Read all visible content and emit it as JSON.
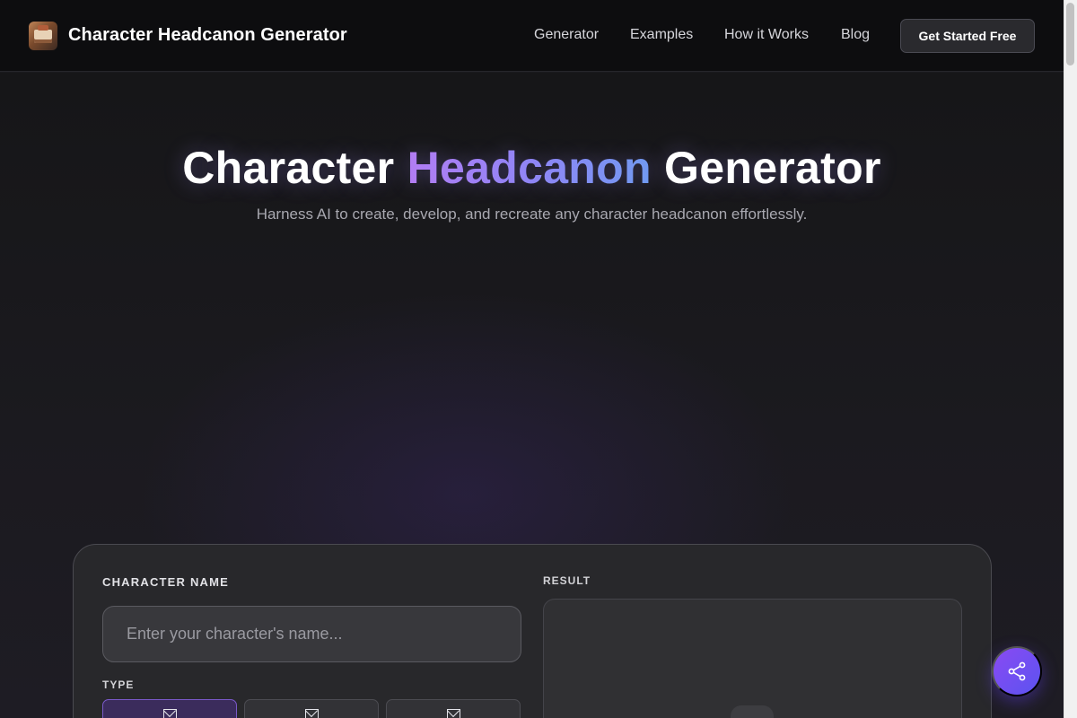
{
  "header": {
    "brand": "Character Headcanon Generator",
    "nav": [
      "Generator",
      "Examples",
      "How it Works",
      "Blog"
    ],
    "cta_label": "Get Started Free"
  },
  "hero": {
    "title_before": "Character",
    "title_accent": "Headcanon",
    "title_after": "Generator",
    "subtitle": "Harness AI to create, develop, and recreate any character headcanon effortlessly."
  },
  "form": {
    "name_label": "CHARACTER NAME",
    "name_placeholder": "Enter your character's name...",
    "type_label": "TYPE",
    "result_label": "RESULT"
  },
  "icons": {
    "logo": "headcanon-logo-icon",
    "type": "mail-icon",
    "share": "share-icon"
  },
  "colors": {
    "accent_start": "#b57cf2",
    "accent_end": "#6d9cf0",
    "active_type": "#3b2c5c",
    "share_fab": "#7a4ff2"
  }
}
